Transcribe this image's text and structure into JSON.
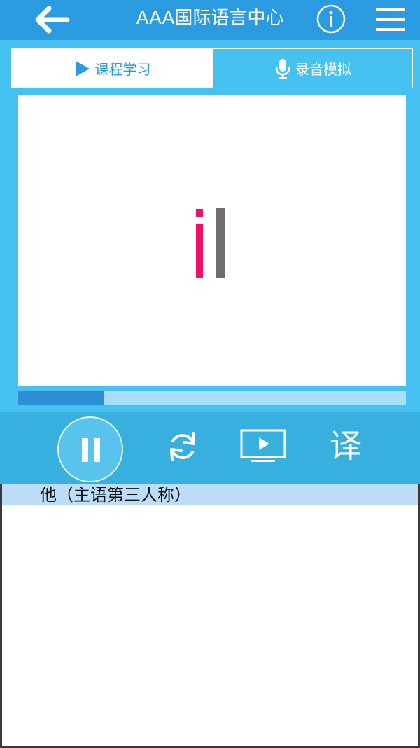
{
  "header": {
    "title": "AAA国际语言中心",
    "icons": {
      "back": "arrow-left-icon",
      "info": "info-icon",
      "menu": "hamburger-menu-icon"
    }
  },
  "tabs": [
    {
      "label": "课程学习",
      "icon": "play-triangle-icon",
      "active": true
    },
    {
      "label": "录音模拟",
      "icon": "microphone-icon",
      "active": false
    }
  ],
  "stage": {
    "letters": [
      {
        "char": "i",
        "color": "#f0106a"
      },
      {
        "char": "l",
        "color": "#6e6e6e"
      }
    ]
  },
  "progress": {
    "fraction": 0.22
  },
  "controls": {
    "icons": [
      "pause-icon",
      "refresh-icon",
      "video-play-icon"
    ],
    "translate_label": "译"
  },
  "subtitle": {
    "text": "他（主语第三人称）"
  },
  "colors": {
    "header": "#2a9be0",
    "panel": "#45c1f2",
    "controls": "#38b0df",
    "subtitle_bg": "#bcdcf8",
    "progress_fill": "#2a8fd6",
    "progress_track": "#a8def6"
  }
}
